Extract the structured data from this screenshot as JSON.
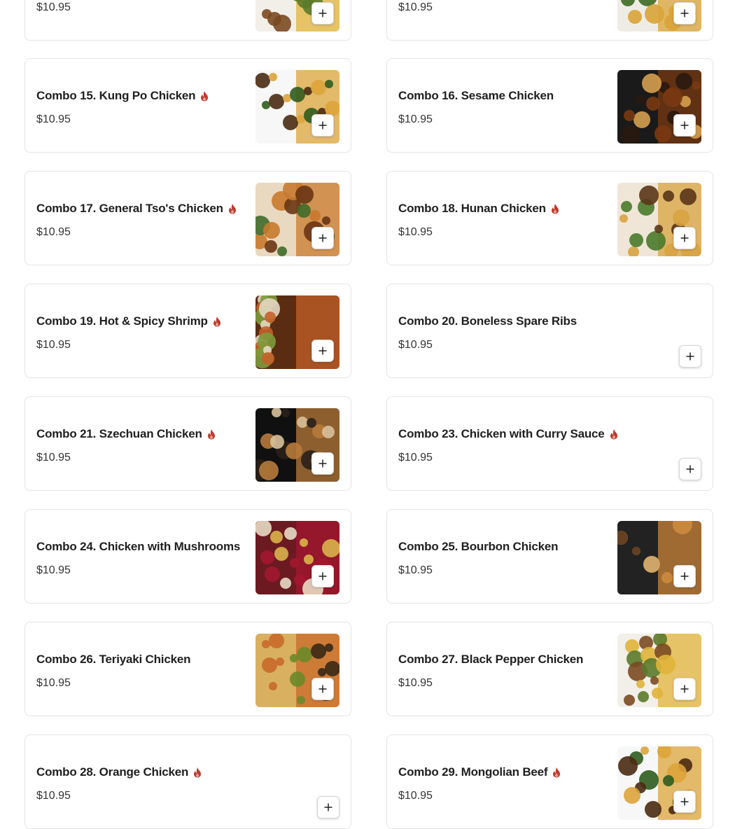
{
  "items": [
    {
      "name": "",
      "price": "$10.95",
      "spicy": false,
      "has_image": true,
      "image": "combo-plate-fried-rice"
    },
    {
      "name": "",
      "price": "$10.95",
      "spicy": false,
      "has_image": true,
      "image": "combo-plate-fried-rice"
    },
    {
      "name": "Combo 15. Kung Po Chicken",
      "price": "$10.95",
      "spicy": true,
      "has_image": true,
      "image": "kung-po-chicken-photo"
    },
    {
      "name": "Combo 16. Sesame Chicken",
      "price": "$10.95",
      "spicy": false,
      "has_image": true,
      "image": "sesame-chicken-photo"
    },
    {
      "name": "Combo 17. General Tso's Chicken",
      "price": "$10.95",
      "spicy": true,
      "has_image": true,
      "image": "general-tsos-chicken-photo"
    },
    {
      "name": "Combo 18. Hunan Chicken",
      "price": "$10.95",
      "spicy": true,
      "has_image": true,
      "image": "hunan-chicken-photo"
    },
    {
      "name": "Combo 19. Hot & Spicy Shrimp",
      "price": "$10.95",
      "spicy": true,
      "has_image": true,
      "image": "hot-spicy-shrimp-photo"
    },
    {
      "name": "Combo 20. Boneless Spare Ribs",
      "price": "$10.95",
      "spicy": false,
      "has_image": false,
      "image": ""
    },
    {
      "name": "Combo 21. Szechuan Chicken",
      "price": "$10.95",
      "spicy": true,
      "has_image": true,
      "image": "szechuan-chicken-photo"
    },
    {
      "name": "Combo 23. Chicken with Curry Sauce",
      "price": "$10.95",
      "spicy": true,
      "has_image": false,
      "image": ""
    },
    {
      "name": "Combo 24. Chicken with Mushrooms",
      "price": "$10.95",
      "spicy": false,
      "has_image": true,
      "image": "chicken-mushrooms-photo"
    },
    {
      "name": "Combo 25. Bourbon Chicken",
      "price": "$10.95",
      "spicy": false,
      "has_image": true,
      "image": "bourbon-chicken-photo"
    },
    {
      "name": "Combo 26. Teriyaki Chicken",
      "price": "$10.95",
      "spicy": false,
      "has_image": true,
      "image": "teriyaki-chicken-photo"
    },
    {
      "name": "Combo 27. Black Pepper Chicken",
      "price": "$10.95",
      "spicy": false,
      "has_image": true,
      "image": "black-pepper-chicken-photo"
    },
    {
      "name": "Combo 28. Orange Chicken",
      "price": "$10.95",
      "spicy": true,
      "has_image": false,
      "image": ""
    },
    {
      "name": "Combo 29. Mongolian Beef",
      "price": "$10.95",
      "spicy": true,
      "has_image": true,
      "image": "mongolian-beef-photo"
    }
  ],
  "icons": {
    "spicy": "flame-icon",
    "add": "plus-icon"
  },
  "colors": {
    "spicy": "#c0392b",
    "border": "#e4e4e4",
    "text": "#1f1f1f"
  }
}
